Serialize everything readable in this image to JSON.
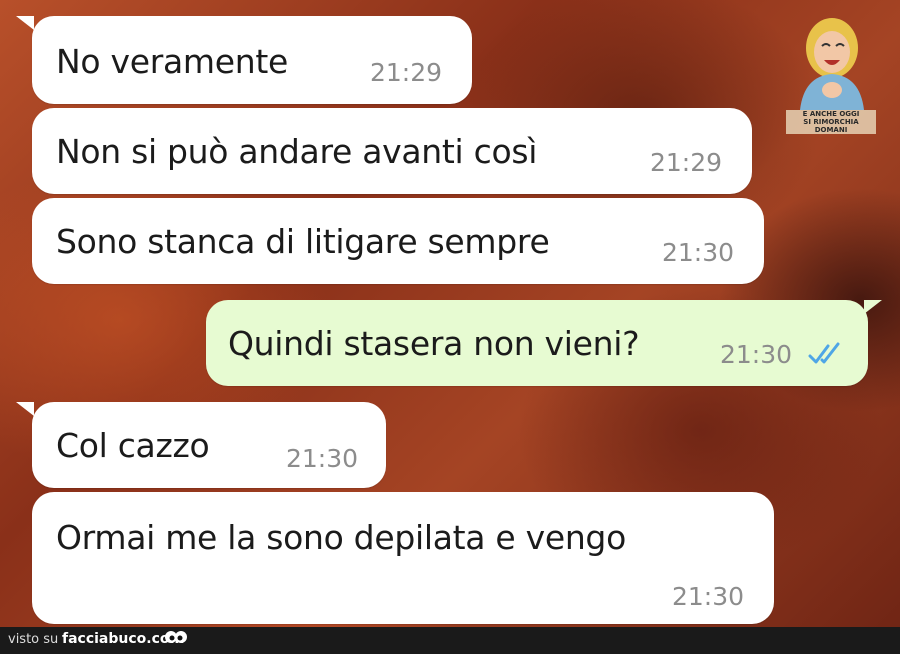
{
  "messages": [
    {
      "direction": "incoming",
      "text": "No veramente",
      "time": "21:29"
    },
    {
      "direction": "incoming",
      "text": "Non si può andare avanti così",
      "time": "21:29"
    },
    {
      "direction": "incoming",
      "text": "Sono stanca di litigare sempre",
      "time": "21:30"
    },
    {
      "direction": "outgoing",
      "text": "Quindi stasera non vieni?",
      "time": "21:30",
      "status_icon": "double-check-read-icon"
    },
    {
      "direction": "incoming",
      "text": "Col cazzo",
      "time": "21:30"
    },
    {
      "direction": "incoming",
      "text": "Ormai me la sono depilata e vengo",
      "time": "21:30"
    }
  ],
  "watermark": {
    "caption_line1": "E ANCHE OGGI",
    "caption_line2": "SI RIMORCHIA DOMANI"
  },
  "footer": {
    "prefix": "visto su",
    "site": "facciabuco.com"
  },
  "colors": {
    "incoming_bubble": "#ffffff",
    "outgoing_bubble": "#e7fbd2",
    "read_ticks": "#4fa6e6",
    "timestamp": "#8c8c8c"
  }
}
